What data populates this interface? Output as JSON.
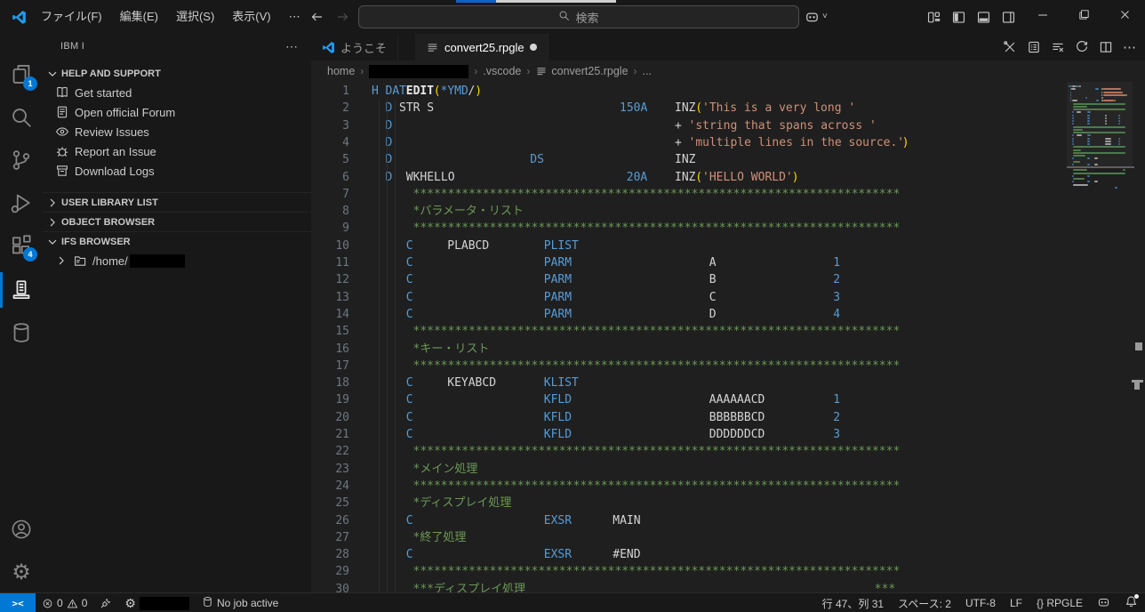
{
  "window": {
    "menus": [
      "ファイル(F)",
      "編集(E)",
      "選択(S)",
      "表示(V)"
    ],
    "menus_more": "⋯",
    "search_placeholder": "検索",
    "top_accent": {
      "blue": "#0a65c8",
      "light": "#cfd0d0"
    }
  },
  "activity_bar": {
    "items": [
      {
        "name": "explorer",
        "icon": "files",
        "badge": "1"
      },
      {
        "name": "search",
        "icon": "search"
      },
      {
        "name": "source-control",
        "icon": "git"
      },
      {
        "name": "run-and-debug",
        "icon": "debug"
      },
      {
        "name": "extensions",
        "icon": "extensions",
        "badge": "4"
      },
      {
        "name": "ibm-i",
        "icon": "ibmi",
        "active": true
      },
      {
        "name": "databases",
        "icon": "database"
      }
    ],
    "bottom": [
      {
        "name": "accounts",
        "icon": "account"
      },
      {
        "name": "settings",
        "icon": "gear"
      }
    ]
  },
  "sidebar": {
    "title": "IBM I",
    "more": "⋯",
    "sections": [
      {
        "label": "HELP AND SUPPORT",
        "expanded": true,
        "items": [
          {
            "icon": "book",
            "label": "Get started"
          },
          {
            "icon": "note",
            "label": "Open official Forum"
          },
          {
            "icon": "eye",
            "label": "Review Issues"
          },
          {
            "icon": "bug",
            "label": "Report an Issue"
          },
          {
            "icon": "archive",
            "label": "Download Logs"
          }
        ]
      },
      {
        "label": "USER LIBRARY LIST",
        "expanded": false,
        "items": []
      },
      {
        "label": "OBJECT BROWSER",
        "expanded": false,
        "items": []
      },
      {
        "label": "IFS BROWSER",
        "expanded": true,
        "items": [
          {
            "icon": "folder",
            "label": "/home/",
            "redacted": true
          }
        ]
      }
    ]
  },
  "tabs": [
    {
      "label": "ようこそ",
      "icon": "vscode",
      "active": false,
      "modified": false
    },
    {
      "label": "convert25.rpgle",
      "icon": "filelines",
      "active": true,
      "modified": true
    }
  ],
  "editor_actions": [
    "tools",
    "card",
    "clearlist",
    "refresh",
    "split",
    "more"
  ],
  "breadcrumb": [
    {
      "label": "home"
    },
    {
      "redacted": true
    },
    {
      "label": ".vscode"
    },
    {
      "label": "convert25.rpgle",
      "icon": "filelines"
    },
    {
      "label": "..."
    }
  ],
  "editor": {
    "first_line": 1,
    "ast_line": "**********************************************************************",
    "lines": [
      [
        [
          0,
          "H",
          "kw"
        ],
        [
          2,
          "DAT",
          "kw"
        ],
        [
          5,
          "EDIT",
          "em"
        ],
        [
          9,
          "(",
          "br"
        ],
        [
          10,
          "*YMD",
          "kw"
        ],
        [
          14,
          "/",
          "fg"
        ],
        [
          15,
          ")",
          "br"
        ]
      ],
      [
        [
          2,
          "D",
          "kw"
        ],
        [
          4,
          "STR S",
          "fg"
        ],
        [
          36,
          "150A",
          "kw"
        ],
        [
          44,
          "INZ",
          "fg"
        ],
        [
          47,
          "(",
          "br"
        ],
        [
          48,
          "'This is a very long '",
          "str"
        ]
      ],
      [
        [
          2,
          "D",
          "kw"
        ],
        [
          44,
          "+",
          "fg"
        ],
        [
          46,
          "'string that spans across '",
          "str"
        ]
      ],
      [
        [
          2,
          "D",
          "kw"
        ],
        [
          44,
          "+",
          "fg"
        ],
        [
          46,
          "'multiple lines in the source.'",
          "str"
        ],
        [
          77,
          ")",
          "br"
        ]
      ],
      [
        [
          2,
          "D",
          "kw"
        ],
        [
          23,
          "DS",
          "kw"
        ],
        [
          44,
          "INZ",
          "fg"
        ]
      ],
      [
        [
          2,
          "D",
          "kw"
        ],
        [
          5,
          "WKHELLO",
          "fg"
        ],
        [
          37,
          "20A",
          "kw"
        ],
        [
          44,
          "INZ",
          "fg"
        ],
        [
          47,
          "(",
          "br"
        ],
        [
          48,
          "'HELLO WORLD'",
          "str"
        ],
        [
          61,
          ")",
          "br"
        ]
      ],
      [
        [
          6,
          "@ast",
          "cm"
        ]
      ],
      [
        [
          6,
          "*パラメータ・リスト",
          "cm"
        ]
      ],
      [
        [
          6,
          "@ast",
          "cm"
        ]
      ],
      [
        [
          5,
          "C",
          "kw"
        ],
        [
          11,
          "PLABCD",
          "fg"
        ],
        [
          25,
          "PLIST",
          "kw"
        ]
      ],
      [
        [
          5,
          "C",
          "kw"
        ],
        [
          25,
          "PARM",
          "kw"
        ],
        [
          49,
          "A",
          "fg"
        ],
        [
          67,
          "1",
          "kw"
        ]
      ],
      [
        [
          5,
          "C",
          "kw"
        ],
        [
          25,
          "PARM",
          "kw"
        ],
        [
          49,
          "B",
          "fg"
        ],
        [
          67,
          "2",
          "kw"
        ]
      ],
      [
        [
          5,
          "C",
          "kw"
        ],
        [
          25,
          "PARM",
          "kw"
        ],
        [
          49,
          "C",
          "fg"
        ],
        [
          67,
          "3",
          "kw"
        ]
      ],
      [
        [
          5,
          "C",
          "kw"
        ],
        [
          25,
          "PARM",
          "kw"
        ],
        [
          49,
          "D",
          "fg"
        ],
        [
          67,
          "4",
          "kw"
        ]
      ],
      [
        [
          6,
          "@ast",
          "cm"
        ]
      ],
      [
        [
          6,
          "*キー・リスト",
          "cm"
        ]
      ],
      [
        [
          6,
          "@ast",
          "cm"
        ]
      ],
      [
        [
          5,
          "C",
          "kw"
        ],
        [
          11,
          "KEYABCD",
          "fg"
        ],
        [
          25,
          "KLIST",
          "kw"
        ]
      ],
      [
        [
          5,
          "C",
          "kw"
        ],
        [
          25,
          "KFLD",
          "kw"
        ],
        [
          49,
          "AAAAAACD",
          "fg"
        ],
        [
          67,
          "1",
          "kw"
        ]
      ],
      [
        [
          5,
          "C",
          "kw"
        ],
        [
          25,
          "KFLD",
          "kw"
        ],
        [
          49,
          "BBBBBBCD",
          "fg"
        ],
        [
          67,
          "2",
          "kw"
        ]
      ],
      [
        [
          5,
          "C",
          "kw"
        ],
        [
          25,
          "KFLD",
          "kw"
        ],
        [
          49,
          "DDDDDDCD",
          "fg"
        ],
        [
          67,
          "3",
          "kw"
        ]
      ],
      [
        [
          6,
          "@ast",
          "cm"
        ]
      ],
      [
        [
          6,
          "*メイン処理",
          "cm"
        ]
      ],
      [
        [
          6,
          "@ast",
          "cm"
        ]
      ],
      [
        [
          6,
          "*ディスプレイ処理",
          "cm"
        ]
      ],
      [
        [
          5,
          "C",
          "kw"
        ],
        [
          25,
          "EXSR",
          "kw"
        ],
        [
          35,
          "MAIN",
          "fg"
        ]
      ],
      [
        [
          6,
          "*終了処理",
          "cm"
        ]
      ],
      [
        [
          5,
          "C",
          "kw"
        ],
        [
          25,
          "EXSR",
          "kw"
        ],
        [
          35,
          "#END",
          "fg"
        ]
      ],
      [
        [
          6,
          "@ast",
          "cm"
        ]
      ],
      [
        [
          6,
          "***ディスプレイ処理",
          "cm"
        ],
        [
          73,
          "***",
          "cm"
        ]
      ]
    ],
    "minimap_extra": [
      [
        [
          6,
          70,
          "cm"
        ]
      ],
      [
        [
          5,
          1,
          "kw"
        ],
        [
          25,
          4,
          "kw"
        ]
      ],
      [
        [
          6,
          16,
          "cm"
        ]
      ],
      [
        [
          5,
          1,
          "kw"
        ],
        [
          25,
          4,
          "kw"
        ],
        [
          35,
          4,
          "fg"
        ]
      ],
      [
        [
          6,
          20,
          "fg"
        ]
      ],
      [
        [
          62,
          3,
          "kw"
        ]
      ]
    ]
  },
  "status_bar": {
    "remote_glyph": "><",
    "errors": "0",
    "warnings": "0",
    "job_status": "No job active",
    "right": [
      {
        "label": "行 47、列 31"
      },
      {
        "label": "スペース: 2"
      },
      {
        "label": "UTF-8"
      },
      {
        "label": "LF"
      },
      {
        "label": "{} RPGLE"
      },
      {
        "icon": "robot"
      },
      {
        "icon": "bell",
        "badge": true
      }
    ]
  },
  "colors": {
    "accent_blue": "#0078d4",
    "keyword": "#569cd6",
    "string": "#ce9178",
    "comment": "#6a9955",
    "bracket": "#ffd700",
    "text": "#d4d4d4"
  }
}
